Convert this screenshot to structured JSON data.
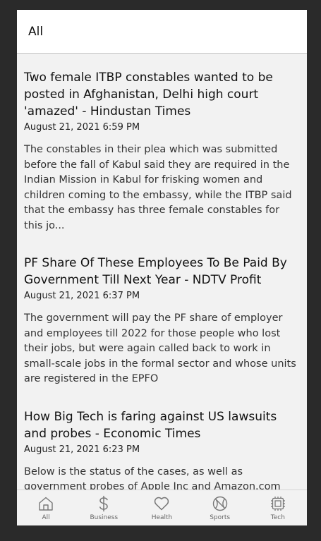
{
  "header": {
    "title": "All"
  },
  "articles": [
    {
      "title": "Two female ITBP constables wanted to be posted in Afghanistan, Delhi high court 'amazed' - Hindustan Times",
      "date": "August 21, 2021 6:59 PM",
      "summary": "The constables in their plea which was submitted before the fall of Kabul said they are required in the Indian Mission in Kabul for frisking women and children coming to the embassy, while the ITBP said that the embassy has three female constables for this jo..."
    },
    {
      "title": "PF Share Of These Employees To Be Paid By Government Till Next Year - NDTV Profit",
      "date": "August 21, 2021 6:37 PM",
      "summary": "The government will pay the PF share of employer and employees till 2022 for those people who lost their jobs, but were again called back to work in small-scale jobs in the formal sector and whose units are registered in the EPFO"
    },
    {
      "title": "How Big Tech is faring against US lawsuits and probes - Economic Times",
      "date": "August 21, 2021 6:23 PM",
      "summary": "Below is the status of the cases, as well as government probes of Apple Inc and Amazon.com Inc."
    }
  ],
  "nav": {
    "items": [
      {
        "label": "All",
        "icon": "home-icon"
      },
      {
        "label": "Business",
        "icon": "dollar-icon"
      },
      {
        "label": "Health",
        "icon": "heart-icon"
      },
      {
        "label": "Sports",
        "icon": "ball-icon"
      },
      {
        "label": "Tech",
        "icon": "chip-icon"
      }
    ]
  }
}
